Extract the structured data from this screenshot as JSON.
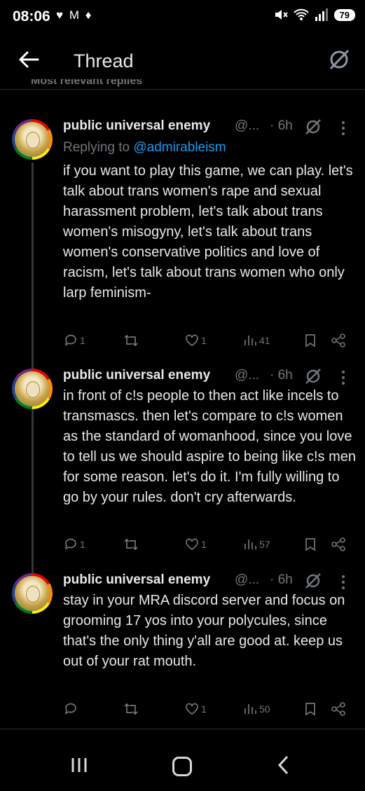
{
  "status_bar": {
    "time": "08:06",
    "notif_icons": [
      "chat-bubble-icon",
      "chat-bubble-icon",
      "gmail-icon",
      "messenger-icon"
    ],
    "notif_text": "♥ M ♦",
    "battery": "79",
    "signal_label": "5"
  },
  "header": {
    "title": "Thread",
    "partial_label": "Most relevant replies"
  },
  "posts": [
    {
      "name": "public universal enemy",
      "handle": "@...",
      "time": "· 6h",
      "reply_prefix": "Replying to ",
      "reply_handle": "@admirableism",
      "text": "if you want to play this game, we can play. let's talk about trans women's rape and sexual harassment problem, let's talk about trans women's misogyny, let's talk about trans women's conservative politics and love of racism, let's talk about trans women who only larp feminism-",
      "replies": "1",
      "reposts": "",
      "likes": "1",
      "views": "41"
    },
    {
      "name": "public universal enemy",
      "handle": "@...",
      "time": "· 6h",
      "text": "in front of c!s people to then act like incels to transmascs. then let's compare to c!s women as the standard of womanhood, since you love to tell us we should aspire to being like c!s men for some reason. let's do it. I'm fully willing to go by your rules. don't cry afterwards.",
      "replies": "1",
      "reposts": "",
      "likes": "1",
      "views": "57"
    },
    {
      "name": "public universal enemy",
      "handle": "@...",
      "time": "· 6h",
      "text": "stay in your MRA discord server and focus on grooming 17 yos into your polycules, since that's the only thing y'all are good at. keep us out of your rat mouth.",
      "replies": "",
      "reposts": "",
      "likes": "1",
      "views": "50"
    }
  ]
}
